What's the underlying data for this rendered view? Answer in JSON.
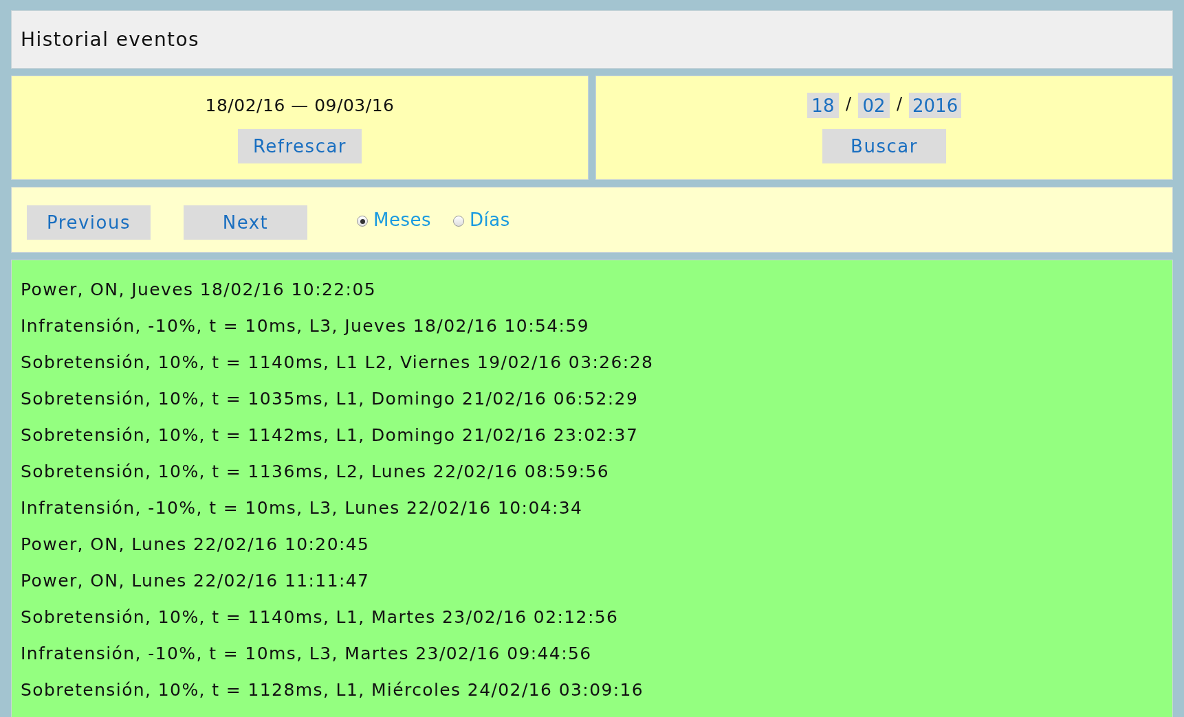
{
  "header": {
    "title": "Historial eventos"
  },
  "range_panel": {
    "range": "18/02/16 — 09/03/16",
    "button": "Refrescar"
  },
  "search_panel": {
    "day": "18",
    "separator_1": "/",
    "month": "02",
    "separator_2": "/",
    "year": "2016",
    "button": "Buscar"
  },
  "navigation": {
    "buttons": [
      "Previous",
      "Next"
    ],
    "options": [
      {
        "label": "Meses",
        "selected": true
      },
      {
        "label": "Días",
        "selected": false
      }
    ]
  },
  "events": [
    "Power, ON, Jueves 18/02/16 10:22:05",
    "Infratensión, -10%, t = 10ms, L3, Jueves 18/02/16 10:54:59",
    "Sobretensión, 10%, t = 1140ms, L1 L2, Viernes 19/02/16 03:26:28",
    "Sobretensión, 10%, t = 1035ms, L1, Domingo 21/02/16 06:52:29",
    "Sobretensión, 10%, t = 1142ms, L1, Domingo 21/02/16 23:02:37",
    "Sobretensión, 10%, t = 1136ms, L2, Lunes 22/02/16 08:59:56",
    "Infratensión, -10%, t = 10ms, L3, Lunes 22/02/16 10:04:34",
    "Power, ON, Lunes 22/02/16 10:20:45",
    "Power, ON, Lunes 22/02/16 11:11:47",
    "Sobretensión, 10%, t = 1140ms, L1, Martes 23/02/16 02:12:56",
    "Infratensión, -10%, t = 10ms, L3, Martes 23/02/16 09:44:56",
    "Sobretensión, 10%, t = 1128ms, L1, Miércoles 24/02/16 03:09:16"
  ]
}
